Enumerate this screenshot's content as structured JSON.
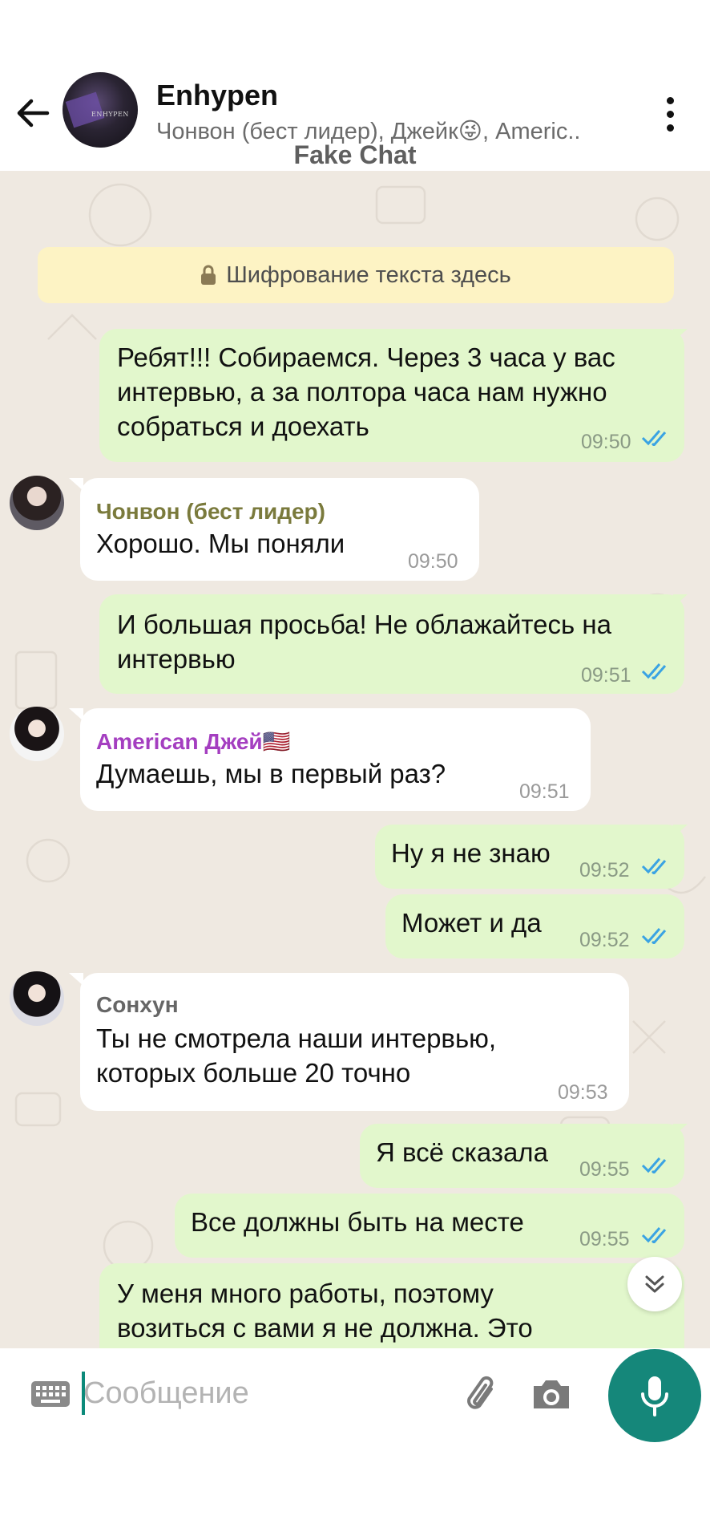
{
  "header": {
    "title": "Enhypen",
    "subtitle": "Чонвон (бест лидер), Джейк😜, Americ..",
    "watermark": "Fake Chat",
    "avatar_text": "ENHYPEN"
  },
  "encryption_notice": "Шифрование текста здесь",
  "messages": [
    {
      "direction": "out",
      "lines": [
        "Ребят!!! Собираемся. Через 3 часа у вас",
        "интервью, а за полтора часа нам нужно",
        "собраться и доехать"
      ],
      "time": "09:50",
      "status": "read"
    },
    {
      "direction": "in",
      "sender": "Чонвон (бест лидер)",
      "sender_color": "#7a7a3c",
      "lines": [
        "Хорошо. Мы поняли"
      ],
      "time": "09:50"
    },
    {
      "direction": "out",
      "lines": [
        "И большая просьба! Не облажайтесь на",
        "интервью"
      ],
      "time": "09:51",
      "status": "read"
    },
    {
      "direction": "in",
      "sender": "American Джей🇺🇸",
      "sender_color": "#a43ec0",
      "lines": [
        "Думаешь, мы в первый раз?"
      ],
      "time": "09:51"
    },
    {
      "direction": "out",
      "lines": [
        "Ну я не знаю"
      ],
      "time": "09:52",
      "status": "read"
    },
    {
      "direction": "out",
      "lines": [
        "Может и да"
      ],
      "time": "09:52",
      "status": "read"
    },
    {
      "direction": "in",
      "sender": "Сонхун",
      "sender_color": "#666666",
      "lines": [
        "Ты не смотрела наши интервью,",
        "которых больше 20 точно"
      ],
      "time": "09:53"
    },
    {
      "direction": "out",
      "lines": [
        "Я всё сказала"
      ],
      "time": "09:55",
      "status": "read"
    },
    {
      "direction": "out",
      "lines": [
        "Все должны быть на месте"
      ],
      "time": "09:55",
      "status": "read"
    },
    {
      "direction": "out",
      "lines": [
        "У меня много работы, поэтому",
        "возиться с вами я не должна. Это"
      ],
      "time": "",
      "status": ""
    }
  ],
  "input": {
    "placeholder": "Сообщение",
    "value": ""
  },
  "colors": {
    "accent": "#15877a",
    "outgoing_bubble": "#e2f7cc",
    "incoming_bubble": "#ffffff",
    "read_ticks": "#3aa3e3",
    "chat_background": "#efe9e1",
    "encryption_banner": "#fdf3c4"
  },
  "icons": {
    "back": "arrow-left-icon",
    "menu": "more-vert-icon",
    "lock": "lock-icon",
    "scroll_down": "double-chevron-down-icon",
    "keyboard": "keyboard-icon",
    "attach": "paperclip-icon",
    "camera": "camera-icon",
    "mic": "microphone-icon"
  }
}
